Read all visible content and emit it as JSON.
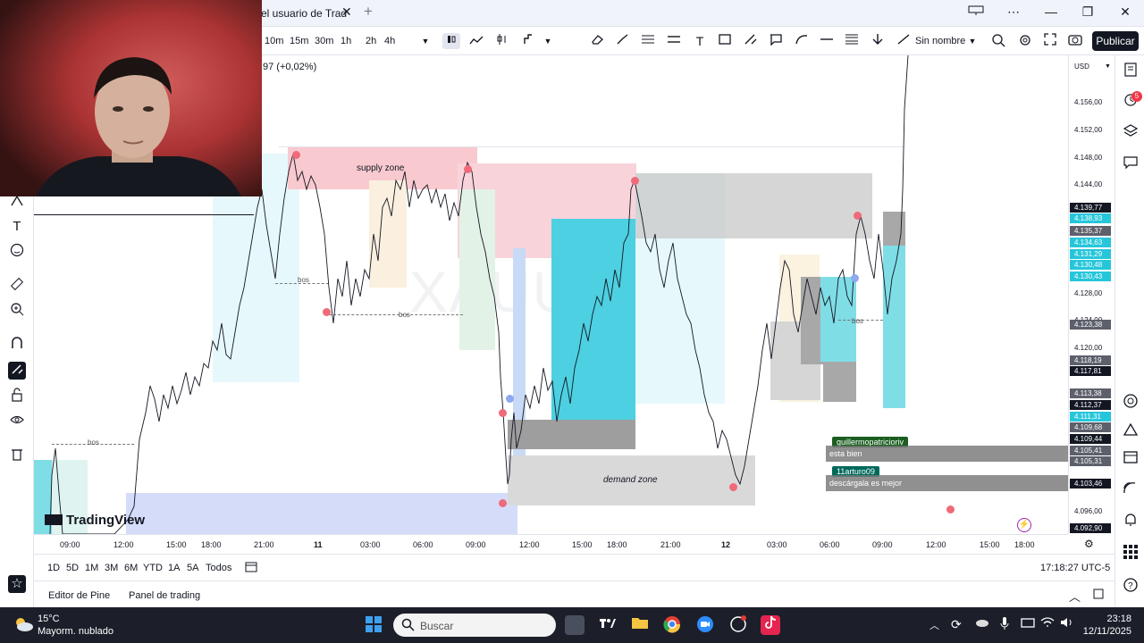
{
  "browser": {
    "tab_title": "el usuario de Trad",
    "close_glyph": "✕",
    "new_tab_glyph": "+",
    "window_controls": {
      "more": "⋯",
      "minimize": "—",
      "maximize": "❐",
      "close": "✕"
    }
  },
  "toolbar": {
    "timeframes": [
      "10m",
      "15m",
      "30m",
      "1h",
      "2h",
      "4h"
    ],
    "layout_name": "Sin nombre",
    "publish_label": "Publicar",
    "text_tool_glyph": "T"
  },
  "chart": {
    "symbol_watermark": "XAUUSD, 3",
    "ohlc_change": "97 (+0,02%)",
    "logo_text": "TradingView",
    "zones": {
      "supply_label": "supply zone",
      "demand_label": "demand zone",
      "bos_label": "bos"
    }
  },
  "price_axis": {
    "currency": "USD",
    "ticks": [
      "4.156,00",
      "4.152,00",
      "4.148,00",
      "4.144,00",
      "4.128,00",
      "4.124,00",
      "4.120,00",
      "4.096,00"
    ],
    "labels": [
      {
        "text": "4.139,77",
        "color": "#131722"
      },
      {
        "text": "4.138,93",
        "color": "#26c6da"
      },
      {
        "text": "4.135,37",
        "color": "#5d606b"
      },
      {
        "text": "4.134,63",
        "color": "#26c6da"
      },
      {
        "text": "4.131,29",
        "color": "#26c6da"
      },
      {
        "text": "4.130,48",
        "color": "#26c6da"
      },
      {
        "text": "4.130,43",
        "color": "#26c6da"
      },
      {
        "text": "4.123,38",
        "color": "#5d606b"
      },
      {
        "text": "4.118,19",
        "color": "#5d606b"
      },
      {
        "text": "4.117,81",
        "color": "#131722"
      },
      {
        "text": "4.113,38",
        "color": "#5d606b"
      },
      {
        "text": "4.112,37",
        "color": "#131722"
      },
      {
        "text": "4.111,31",
        "color": "#26c6da"
      },
      {
        "text": "4.109,68",
        "color": "#5d606b"
      },
      {
        "text": "4.109,44",
        "color": "#131722"
      },
      {
        "text": "4.105,41",
        "color": "#5d606b"
      },
      {
        "text": "4.105,31",
        "color": "#5d606b"
      },
      {
        "text": "4.103,46",
        "color": "#131722"
      },
      {
        "text": "4.092,90",
        "color": "#131722"
      }
    ]
  },
  "time_axis": {
    "ticks": [
      "09:00",
      "12:00",
      "15:00",
      "18:00",
      "21:00",
      "11",
      "03:00",
      "06:00",
      "09:00",
      "12:00",
      "15:00",
      "18:00",
      "21:00",
      "12",
      "03:00",
      "06:00",
      "09:00",
      "12:00",
      "15:00",
      "18:00"
    ]
  },
  "range_bar": {
    "ranges": [
      "1D",
      "5D",
      "1M",
      "3M",
      "6M",
      "YTD",
      "1A",
      "5A",
      "Todos"
    ],
    "clock": "17:18:27 UTC-5"
  },
  "bottom_panel": {
    "pine_editor": "Editor de Pine",
    "trading_panel": "Panel de trading"
  },
  "chat": [
    {
      "user": "guillermopatricioriv",
      "user_color": "#1b5e20",
      "message": "esta bien"
    },
    {
      "user": "11arturo09",
      "user_color": "#00695c",
      "message": "descárgala es mejor"
    }
  ],
  "taskbar": {
    "weather_temp": "15°C",
    "weather_desc": "Mayorm. nublado",
    "search_placeholder": "Buscar",
    "time": "23:18",
    "date": "12/11/2025"
  },
  "right_sidebar": {
    "alert_count": "5"
  },
  "colors": {
    "supply_zone": "#f8c9cf",
    "demand_zone": "#d9d9d9",
    "cyan_box": "#26c6da",
    "light_cyan": "#dff7fa",
    "blue_box": "#d5dcfa",
    "publish_button": "#131722"
  }
}
